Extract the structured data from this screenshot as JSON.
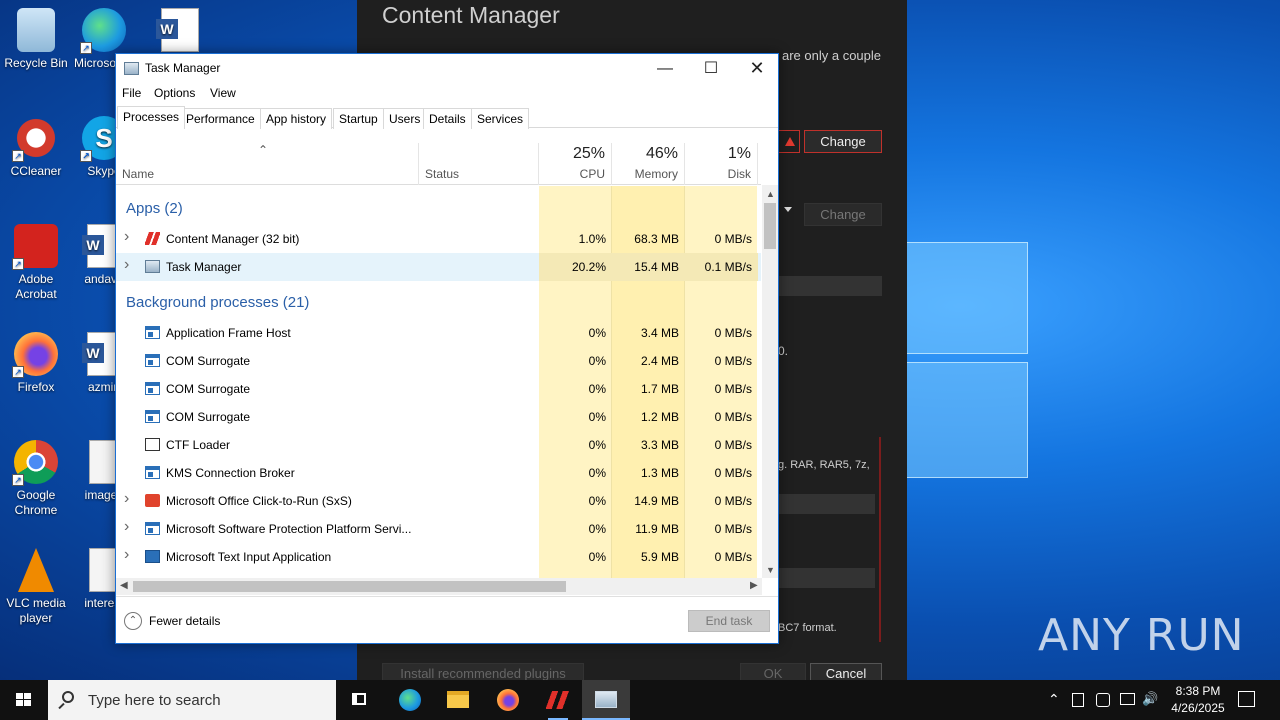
{
  "desktop": {
    "icons": [
      {
        "label": "Recycle Bin",
        "icon": "recycle-bin-icon"
      },
      {
        "label": "Microsoft Edge",
        "icon": "edge-icon"
      },
      {
        "label": "",
        "icon": "word-doc-icon"
      },
      {
        "label": "CCleaner",
        "icon": "ccleaner-icon"
      },
      {
        "label": "Skype",
        "icon": "skype-icon"
      },
      {
        "label": "Adobe Acrobat",
        "icon": "acrobat-icon"
      },
      {
        "label": "andava",
        "icon": "word-doc-icon"
      },
      {
        "label": "Firefox",
        "icon": "firefox-icon"
      },
      {
        "label": "azmin",
        "icon": "word-doc-icon"
      },
      {
        "label": "Google Chrome",
        "icon": "chrome-icon"
      },
      {
        "label": "images",
        "icon": "image-file-icon"
      },
      {
        "label": "VLC media player",
        "icon": "vlc-icon"
      },
      {
        "label": "interest",
        "icon": "image-file-icon"
      }
    ],
    "watermark": "ANY RUN"
  },
  "content_manager": {
    "title": "Content Manager",
    "text_top": "are only a couple",
    "change_label": "Change",
    "change2_label": "Change",
    "text_mid": "0.",
    "text_formats": "g. RAR, RAR5, 7z,",
    "text_bc7": "BC7 format.",
    "install_label": "Install recommended plugins",
    "ok_label": "OK",
    "cancel_label": "Cancel"
  },
  "task_manager": {
    "title": "Task Manager",
    "menu": [
      "File",
      "Options",
      "View"
    ],
    "tabs": [
      "Processes",
      "Performance",
      "App history",
      "Startup",
      "Users",
      "Details",
      "Services"
    ],
    "active_tab": "Processes",
    "columns": {
      "name": "Name",
      "status": "Status",
      "cpu_pct": "25%",
      "cpu": "CPU",
      "mem_pct": "46%",
      "mem": "Memory",
      "disk_pct": "1%",
      "disk": "Disk"
    },
    "groups": {
      "apps": "Apps (2)",
      "background": "Background processes (21)"
    },
    "apps": [
      {
        "name": "Content Manager (32 bit)",
        "cpu": "1.0%",
        "mem": "68.3 MB",
        "disk": "0 MB/s",
        "expandable": true,
        "icon": "content-manager-icon"
      },
      {
        "name": "Task Manager",
        "cpu": "20.2%",
        "mem": "15.4 MB",
        "disk": "0.1 MB/s",
        "expandable": true,
        "icon": "task-manager-icon"
      }
    ],
    "background": [
      {
        "name": "Application Frame Host",
        "cpu": "0%",
        "mem": "3.4 MB",
        "disk": "0 MB/s",
        "expandable": false,
        "icon": "app-window-icon"
      },
      {
        "name": "COM Surrogate",
        "cpu": "0%",
        "mem": "2.4 MB",
        "disk": "0 MB/s",
        "expandable": false,
        "icon": "app-window-icon"
      },
      {
        "name": "COM Surrogate",
        "cpu": "0%",
        "mem": "1.7 MB",
        "disk": "0 MB/s",
        "expandable": false,
        "icon": "app-window-icon"
      },
      {
        "name": "COM Surrogate",
        "cpu": "0%",
        "mem": "1.2 MB",
        "disk": "0 MB/s",
        "expandable": false,
        "icon": "app-window-icon"
      },
      {
        "name": "CTF Loader",
        "cpu": "0%",
        "mem": "3.3 MB",
        "disk": "0 MB/s",
        "expandable": false,
        "icon": "ctf-loader-icon"
      },
      {
        "name": "KMS Connection Broker",
        "cpu": "0%",
        "mem": "1.3 MB",
        "disk": "0 MB/s",
        "expandable": false,
        "icon": "app-window-icon"
      },
      {
        "name": "Microsoft Office Click-to-Run (SxS)",
        "cpu": "0%",
        "mem": "14.9 MB",
        "disk": "0 MB/s",
        "expandable": true,
        "icon": "office-icon"
      },
      {
        "name": "Microsoft Software Protection Platform Servi...",
        "cpu": "0%",
        "mem": "11.9 MB",
        "disk": "0 MB/s",
        "expandable": true,
        "icon": "app-window-icon"
      },
      {
        "name": "Microsoft Text Input Application",
        "cpu": "0%",
        "mem": "5.9 MB",
        "disk": "0 MB/s",
        "expandable": true,
        "icon": "text-input-icon"
      }
    ],
    "fewer_details": "Fewer details",
    "end_task": "End task"
  },
  "taskbar": {
    "search_placeholder": "Type here to search",
    "time": "8:38 PM",
    "date": "4/26/2025",
    "apps": [
      "task-view-icon",
      "edge-icon",
      "file-explorer-icon",
      "firefox-icon",
      "content-manager-icon",
      "task-manager-icon"
    ]
  }
}
